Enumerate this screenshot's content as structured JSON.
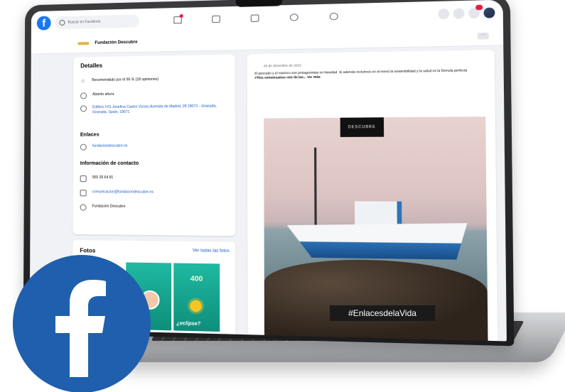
{
  "fb_header": {
    "search_placeholder": "Buscar en Facebook"
  },
  "page": {
    "name": "Fundación Descubre"
  },
  "details": {
    "title": "Detalles",
    "recommended": "Recomendado por el 96 % (18 opiniones)",
    "open_now": "Abierto ahora",
    "address": "Edificio IVG Josefina Castro Vizoso Avenida de Madrid, 28 18071 - Granada, Granada, Spain, 18071",
    "links_title": "Enlaces",
    "website": "fundaciondescubre.es",
    "contact_title": "Información de contacto",
    "phone": "955 35 64 81",
    "email": "comunicacion@fundaciondescubre.es",
    "messenger": "Fundación Descubre"
  },
  "photos": {
    "title": "Fotos",
    "see_all": "Ver todas las fotos",
    "tile2_number": "400",
    "tile3_text": "¿eclipse?"
  },
  "post": {
    "date": "26 de diciembre de 2023 · ",
    "text": "El pescado y el marisco son protagonistas en Navidad. Si además incluimos en el menú la sostenibilidad y la salud es la fórmula perfecta",
    "hashtag_line": "#This conversation nos da las... Ver más",
    "image_brand": "DESCUBRE"
  },
  "overlay": {
    "hashtag": "#EnlacesdelaVida"
  },
  "colors": {
    "facebook_blue": "#1877f2",
    "logo_circle": "#1f5fad",
    "link_blue": "#1b5bc7"
  }
}
